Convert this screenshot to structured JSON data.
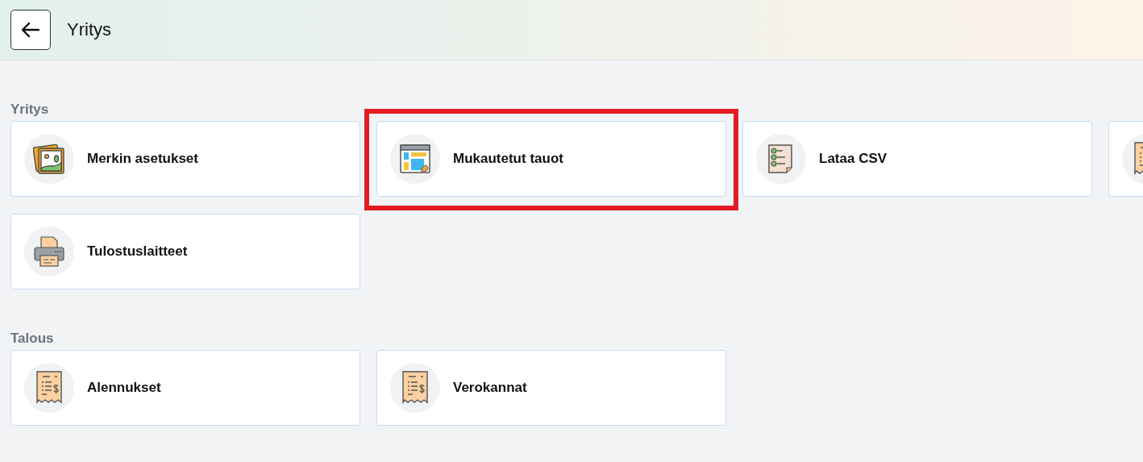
{
  "header": {
    "title": "Yritys"
  },
  "sections": [
    {
      "title": "Yritys",
      "cards": [
        {
          "kind": "pictures",
          "label": "Merkin asetukset",
          "highlighted": false
        },
        {
          "kind": "layout",
          "label": "Mukautetut tauot",
          "highlighted": true
        },
        {
          "kind": "checklist",
          "label": "Lataa CSV",
          "highlighted": false
        },
        {
          "kind": "receipt",
          "highlighted": false
        },
        {
          "kind": "printer",
          "label": "Tulostuslaitteet",
          "highlighted": false
        }
      ]
    },
    {
      "title": "Talous",
      "cards": [
        {
          "kind": "receipt",
          "label": "Alennukset",
          "highlighted": false
        },
        {
          "kind": "receipt",
          "label": "Verokannat",
          "highlighted": false
        }
      ]
    }
  ]
}
